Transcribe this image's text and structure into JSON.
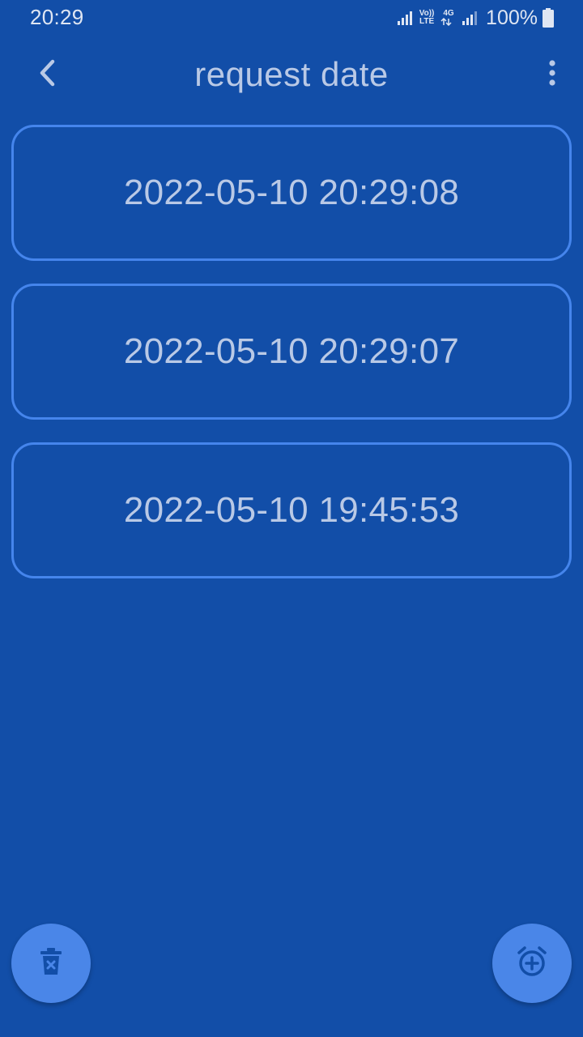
{
  "status_bar": {
    "time": "20:29",
    "volte_label_top": "Vo))",
    "volte_label_bottom": "LTE",
    "network_label": "4G",
    "battery_percent": "100%"
  },
  "app_bar": {
    "title": "request date",
    "back_icon": "chevron-left-icon",
    "menu_icon": "more-vert-icon"
  },
  "dates": [
    {
      "value": "2022-05-10 20:29:08"
    },
    {
      "value": "2022-05-10 20:29:07"
    },
    {
      "value": "2022-05-10 19:45:53"
    }
  ],
  "fabs": {
    "delete_icon": "trash-icon",
    "add_alarm_icon": "alarm-add-icon"
  },
  "colors": {
    "background": "#124ea8",
    "card_border": "#4585ec",
    "text": "#b9c9e6",
    "fab": "#4a86e8"
  }
}
